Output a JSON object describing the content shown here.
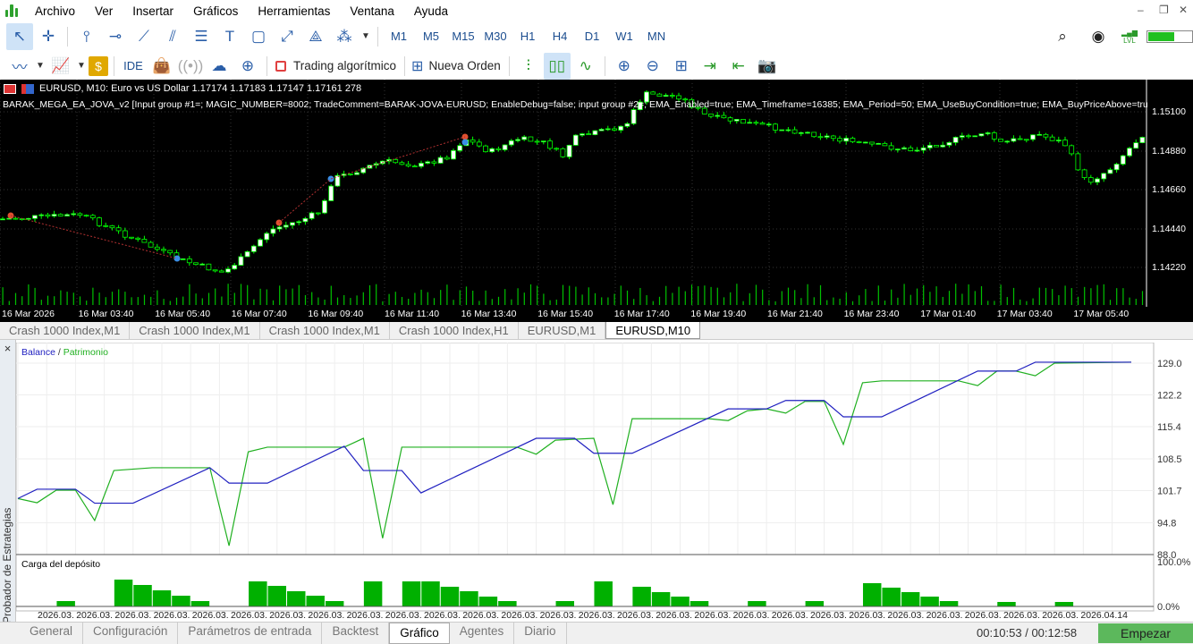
{
  "menu": {
    "items": [
      "Archivo",
      "Ver",
      "Insertar",
      "Gráficos",
      "Herramientas",
      "Ventana",
      "Ayuda"
    ]
  },
  "toolbar1": {
    "tools": [
      "cursor-icon",
      "crosshair-icon",
      "vertical-line-icon",
      "horizontal-line-icon",
      "trendline-icon",
      "channel-icon",
      "fibonacci-icon",
      "text-icon",
      "rectangle-icon",
      "arrows-icon",
      "shapes-icon"
    ],
    "timeframes": [
      "M1",
      "M5",
      "M15",
      "M30",
      "H1",
      "H4",
      "D1",
      "W1",
      "MN"
    ],
    "active_tool": "cursor-icon",
    "signal_label": "LVL"
  },
  "toolbar2": {
    "ide_label": "IDE",
    "algo_label": "Trading algorítmico",
    "new_order_label": "Nueva Orden",
    "active_chart_type": "candles-icon"
  },
  "chart": {
    "symbol_line": "EURUSD, M10:  Euro vs US Dollar  1.17174 1.17183 1.17147 1.17161  278",
    "ea_line": "BARAK_MEGA_EA_JOVA_v2 [Input group #1=; MAGIC_NUMBER=8002; TradeComment=BARAK-JOVA-EURUSD; EnableDebug=false; input group #2=; EMA_Enabled=true; EMA_Timeframe=16385; EMA_Period=50; EMA_UseBuyCondition=true; EMA_BuyPriceAbove=true; EMA_U",
    "price_labels": [
      "1.15100",
      "1.14880",
      "1.14660",
      "1.14440",
      "1.14220"
    ],
    "time_labels": [
      "16 Mar 2026",
      "16 Mar 03:40",
      "16 Mar 05:40",
      "16 Mar 07:40",
      "16 Mar 09:40",
      "16 Mar 11:40",
      "16 Mar 13:40",
      "16 Mar 15:40",
      "16 Mar 17:40",
      "16 Mar 19:40",
      "16 Mar 21:40",
      "16 Mar 23:40",
      "17 Mar 01:40",
      "17 Mar 03:40",
      "17 Mar 05:40"
    ],
    "colors": {
      "background": "#000000",
      "bull": "#ffffff",
      "bear": "#000000",
      "wick": "#00ff00",
      "volume": "#00c000"
    }
  },
  "chart_tabs": [
    {
      "label": "Crash 1000 Index,M1"
    },
    {
      "label": "Crash 1000 Index,M1"
    },
    {
      "label": "Crash 1000 Index,M1"
    },
    {
      "label": "Crash 1000 Index,H1"
    },
    {
      "label": "EURUSD,M1"
    },
    {
      "label": "EURUSD,M10",
      "active": true
    }
  ],
  "tester": {
    "side_title": "Probador de Estrategias",
    "close_label": "×",
    "legend_balance": "Balance",
    "legend_sep": " / ",
    "legend_equity": "Patrimonio",
    "load_title": "Carga del depósito",
    "timer": "00:10:53 / 00:12:58",
    "start_label": "Empezar",
    "tabs": [
      {
        "label": "General"
      },
      {
        "label": "Configuración"
      },
      {
        "label": "Parámetros de entrada"
      },
      {
        "label": "Backtest"
      },
      {
        "label": "Gráfico",
        "active": true
      },
      {
        "label": "Agentes"
      },
      {
        "label": "Diario"
      }
    ]
  },
  "chart_data": [
    {
      "type": "line",
      "ylim": [
        88.0,
        129.0
      ],
      "y_ticks": [
        "129.0",
        "122.2",
        "115.4",
        "108.5",
        "101.7",
        "94.8",
        "88.0"
      ],
      "grid": true,
      "legend": "top-left",
      "x_labels": [
        "2026.03.",
        "2026.03.",
        "2026.03.",
        "2026.03.",
        "2026.03.",
        "2026.03.",
        "2026.03.",
        "2026.03.",
        "2026.03.",
        "2026.03.",
        "2026.03.",
        "2026.03.",
        "2026.03.",
        "2026.03.",
        "2026.03.",
        "2026.03.",
        "2026.03.",
        "2026.03.",
        "2026.03.",
        "2026.03.",
        "2026.03.",
        "2026.03.",
        "2026.03.",
        "2026.03.",
        "2026.03.",
        "2026.03.",
        "2026.03.",
        "2026.04.14"
      ],
      "series": [
        {
          "name": "Balance",
          "color": "#2020c0",
          "points": [
            [
              0,
              100
            ],
            [
              1,
              102
            ],
            [
              3,
              102
            ],
            [
              4,
              99
            ],
            [
              6,
              99
            ],
            [
              10,
              106.6
            ],
            [
              11,
              103.3
            ],
            [
              13,
              103.3
            ],
            [
              17,
              111.2
            ],
            [
              18,
              106
            ],
            [
              20,
              106
            ],
            [
              21,
              101.2
            ],
            [
              27,
              112.9
            ],
            [
              29,
              112.9
            ],
            [
              30,
              109.7
            ],
            [
              32,
              109.7
            ],
            [
              37,
              119.2
            ],
            [
              39,
              119.2
            ],
            [
              40,
              121
            ],
            [
              42,
              121
            ],
            [
              43,
              117.5
            ],
            [
              45,
              117.5
            ],
            [
              50,
              127.3
            ],
            [
              52,
              127.3
            ],
            [
              53,
              129.2
            ],
            [
              58,
              129.2
            ]
          ]
        },
        {
          "name": "Patrimonio",
          "color": "#20b020",
          "points": [
            [
              0,
              100
            ],
            [
              1,
              99.1
            ],
            [
              2,
              101.8
            ],
            [
              3,
              101.8
            ],
            [
              4,
              95.3
            ],
            [
              5,
              106
            ],
            [
              7,
              106.6
            ],
            [
              10,
              106.6
            ],
            [
              11,
              89.9
            ],
            [
              12,
              110
            ],
            [
              13,
              111
            ],
            [
              17,
              111
            ],
            [
              18,
              112.9
            ],
            [
              19,
              91.5
            ],
            [
              20,
              111
            ],
            [
              26,
              111
            ],
            [
              27,
              109.5
            ],
            [
              28,
              112.5
            ],
            [
              30,
              112.9
            ],
            [
              31,
              98.7
            ],
            [
              32,
              117.1
            ],
            [
              36,
              117.1
            ],
            [
              37,
              116.7
            ],
            [
              38,
              118.8
            ],
            [
              39,
              119.2
            ],
            [
              40,
              118.3
            ],
            [
              41,
              120.8
            ],
            [
              42,
              120.8
            ],
            [
              43,
              111.6
            ],
            [
              44,
              124.8
            ],
            [
              45,
              125.2
            ],
            [
              49,
              125.2
            ],
            [
              50,
              124.2
            ],
            [
              51,
              127.3
            ],
            [
              52,
              127.3
            ],
            [
              53,
              126.3
            ],
            [
              54,
              129
            ],
            [
              58,
              129.2
            ]
          ]
        }
      ]
    },
    {
      "type": "bar",
      "title": "Carga del depósito",
      "ylim": [
        0,
        100
      ],
      "y_ticks": [
        "100.0%",
        "0.0%"
      ],
      "color": "#00b000",
      "values": [
        0,
        0,
        12,
        0,
        0,
        60,
        48,
        36,
        24,
        12,
        0,
        0,
        56,
        46,
        34,
        24,
        12,
        0,
        56,
        0,
        56,
        56,
        44,
        34,
        22,
        12,
        0,
        0,
        12,
        0,
        56,
        0,
        44,
        32,
        22,
        12,
        0,
        0,
        12,
        0,
        0,
        12,
        0,
        0,
        52,
        42,
        32,
        22,
        12,
        0,
        0,
        10,
        0,
        0,
        10,
        0,
        0,
        0
      ]
    }
  ]
}
